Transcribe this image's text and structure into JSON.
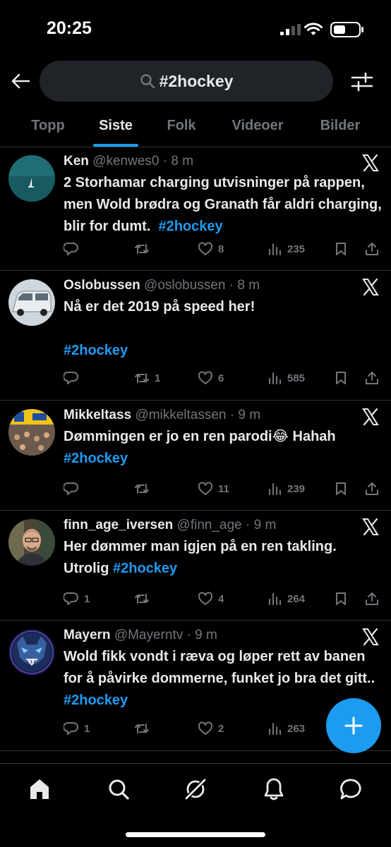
{
  "status_bar": {
    "time": "20:25"
  },
  "search": {
    "query": "#2hockey"
  },
  "tabs": [
    {
      "label": "Topp"
    },
    {
      "label": "Siste"
    },
    {
      "label": "Folk"
    },
    {
      "label": "Videoer"
    },
    {
      "label": "Bilder"
    }
  ],
  "active_tab": "Siste",
  "tweets": [
    {
      "name": "Ken",
      "handle": "@kenwes0",
      "time": "8 m",
      "text": "2 Storhamar charging utvisninger på rappen, men Wold brødra og Granath får aldri charging, blir for dumt.",
      "hashtag": "#2hockey",
      "replies": "",
      "retweets": "",
      "likes": "8",
      "views": "235"
    },
    {
      "name": "Oslobussen",
      "handle": "@oslobussen",
      "time": "8 m",
      "text": "Nå er det 2019 på speed her!",
      "hashtag": "#2hockey",
      "replies": "",
      "retweets": "1",
      "likes": "6",
      "views": "585"
    },
    {
      "name": "Mikkeltass",
      "handle": "@mikkeltassen",
      "time": "9 m",
      "text": "Dømmingen er jo en ren parodi😂 Hahah",
      "hashtag": "#2hockey",
      "replies": "",
      "retweets": "",
      "likes": "11",
      "views": "239"
    },
    {
      "name": "finn_age_iversen",
      "handle": "@finn_age",
      "time": "9 m",
      "text": "Her dømmer man igjen på en ren takling. Utrolig",
      "hashtag": "#2hockey",
      "replies": "1",
      "retweets": "",
      "likes": "4",
      "views": "264"
    },
    {
      "name": "Mayern",
      "handle": "@Mayerntv",
      "time": "9 m",
      "text": "Wold fikk vondt i ræva og løper rett av banen for å påvirke  dommerne, funket jo bra det gitt..",
      "hashtag": "#2hockey",
      "replies": "1",
      "retweets": "",
      "likes": "2",
      "views": "263"
    }
  ],
  "colors": {
    "accent": "#1d9bf0",
    "background": "#000000",
    "text": "#e7e9ea",
    "muted": "#71767b"
  },
  "icons": {
    "header": [
      "back-arrow-icon",
      "search-icon",
      "filter-sliders-icon"
    ],
    "tweet_actions": [
      "reply-icon",
      "retweet-icon",
      "like-icon",
      "views-icon",
      "bookmark-icon",
      "share-icon"
    ],
    "nav": [
      "home-icon",
      "search-icon",
      "grok-icon",
      "notifications-icon",
      "messages-icon"
    ],
    "fab": "plus-icon"
  }
}
